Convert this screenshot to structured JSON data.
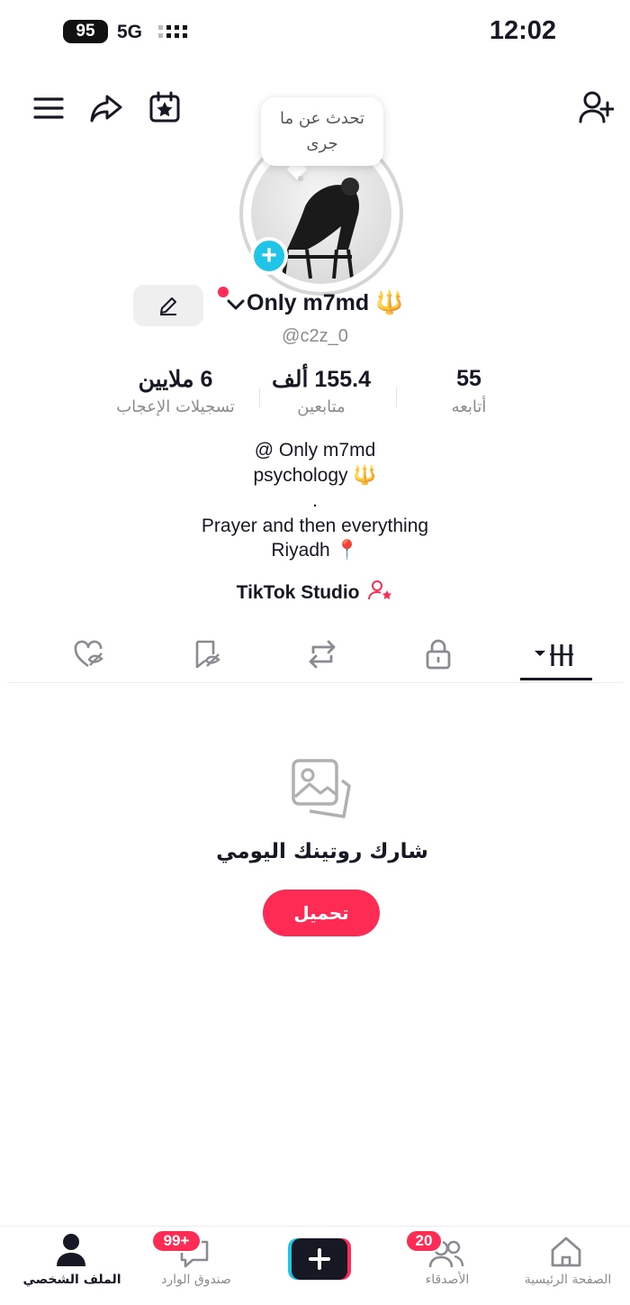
{
  "status_bar": {
    "battery": "95",
    "network": "5G",
    "time": "12:02"
  },
  "header": {
    "icons": [
      "menu-icon",
      "share-icon",
      "calendar-star-icon",
      "add-friend-icon"
    ],
    "note_bubble": {
      "line1": "تحدث عن ما",
      "line2": "جرى"
    }
  },
  "profile": {
    "name": "Only m7md",
    "name_emoji": "🔱",
    "handle": "@c2z_0"
  },
  "stats": [
    {
      "value": "6 ملايين",
      "label": "تسجيلات الإعجاب"
    },
    {
      "value": "155.4 ألف",
      "label": "متابعين"
    },
    {
      "value": "55",
      "label": "أتابعه"
    }
  ],
  "bio": {
    "line1": "@ Only m7md",
    "line2": "psychology 🔱",
    "line3": ".",
    "line4": "Prayer and then everything",
    "line5": "Riyadh 📍"
  },
  "studio_link": "TikTok Studio",
  "tabs": [
    "liked-hidden-icon",
    "favorites-hidden-icon",
    "repost-icon",
    "lock-icon",
    "videos-grid-icon"
  ],
  "empty_state": {
    "title": "شارك روتينك اليومي",
    "button": "تحميل"
  },
  "bottom_nav": {
    "profile": "الملف الشخصي",
    "inbox": "صندوق الوارد",
    "inbox_badge": "99+",
    "friends": "الأصدقاء",
    "friends_badge": "20",
    "home": "الصفحة الرئيسية"
  },
  "colors": {
    "accent": "#fe2c55",
    "cyan": "#20c4e6",
    "text": "#161823",
    "muted": "#8a8b91"
  }
}
